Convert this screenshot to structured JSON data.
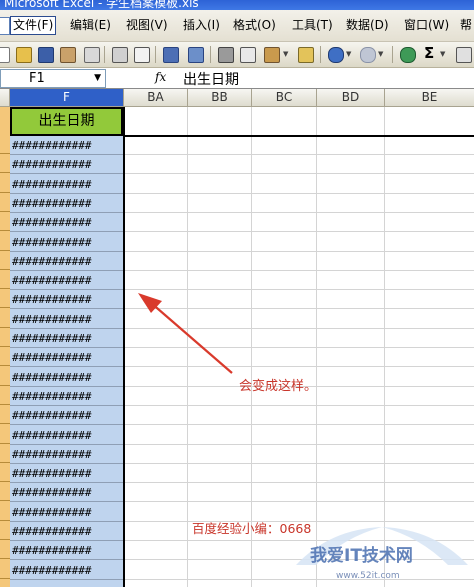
{
  "window": {
    "title": "Microsoft Excel - 学生档案模板.xls"
  },
  "menu": [
    "文件(F)",
    "编辑(E)",
    "视图(V)",
    "插入(I)",
    "格式(O)",
    "工具(T)",
    "数据(D)",
    "窗口(W)",
    "帮"
  ],
  "toolbar": {
    "autosum": "Σ"
  },
  "formula_bar": {
    "name_box": "F1",
    "fx": "fx",
    "content": "出生日期"
  },
  "columns": [
    "F",
    "BA",
    "BB",
    "BC",
    "BD",
    "BE"
  ],
  "header_cell": "出生日期",
  "overflow_cells": [
    "############",
    "############",
    "############",
    "############",
    "############",
    "############",
    "############",
    "############",
    "############",
    "############",
    "############",
    "############",
    "############",
    "############",
    "############",
    "############",
    "############",
    "############",
    "############",
    "############",
    "############",
    "############",
    "############"
  ],
  "annotation": "会变成这样。",
  "watermark": {
    "text": "百度经验小编：0668",
    "logo_text": "我爱IT技术网",
    "logo_url_text": "www.52it.com"
  },
  "colors": {
    "accent_red": "#c8352a",
    "header_green": "#92c93a",
    "selected_column": "#bfd4ee"
  }
}
